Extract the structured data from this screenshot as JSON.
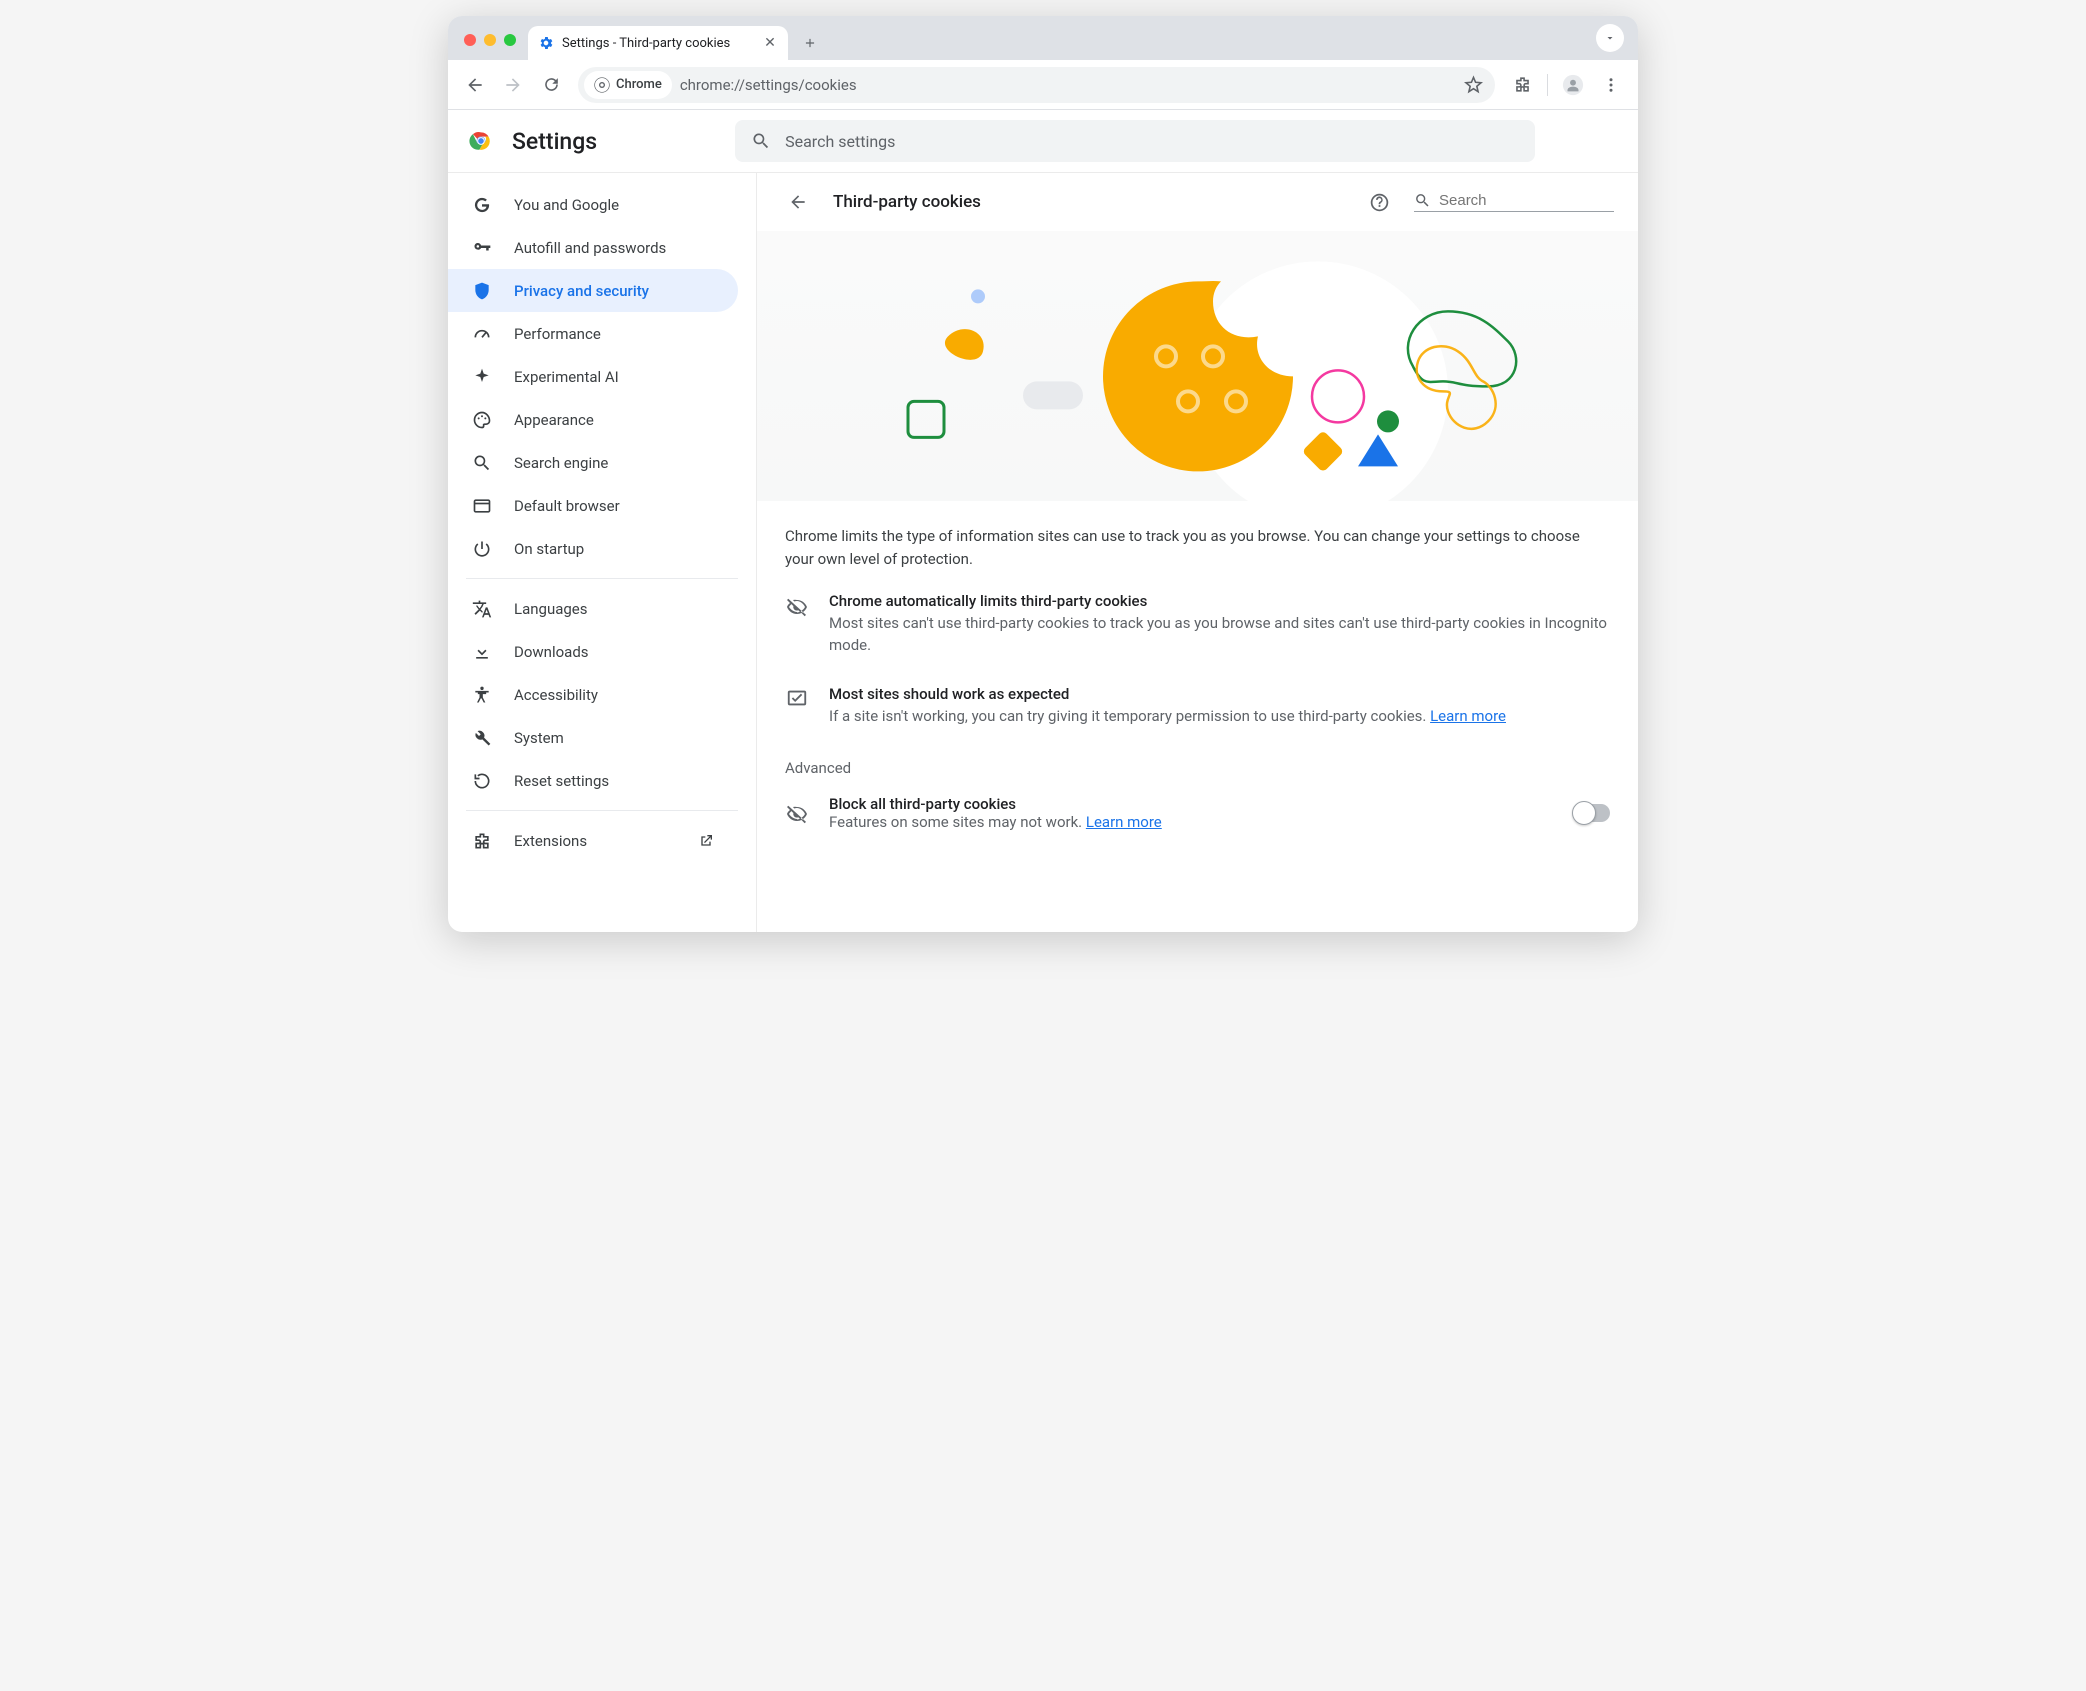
{
  "window": {
    "tab_title": "Settings - Third-party cookies",
    "url": "chrome://settings/cookies",
    "chip_label": "Chrome"
  },
  "header": {
    "title": "Settings",
    "search_placeholder": "Search settings"
  },
  "sidebar": {
    "items": [
      {
        "label": "You and Google"
      },
      {
        "label": "Autofill and passwords"
      },
      {
        "label": "Privacy and security"
      },
      {
        "label": "Performance"
      },
      {
        "label": "Experimental AI"
      },
      {
        "label": "Appearance"
      },
      {
        "label": "Search engine"
      },
      {
        "label": "Default browser"
      },
      {
        "label": "On startup"
      }
    ],
    "items2": [
      {
        "label": "Languages"
      },
      {
        "label": "Downloads"
      },
      {
        "label": "Accessibility"
      },
      {
        "label": "System"
      },
      {
        "label": "Reset settings"
      }
    ],
    "extensions": "Extensions"
  },
  "page": {
    "title": "Third-party cookies",
    "search_placeholder": "Search",
    "description": "Chrome limits the type of information sites can use to track you as you browse. You can change your settings to choose your own level of protection.",
    "info1_title": "Chrome automatically limits third-party cookies",
    "info1_body": "Most sites can't use third-party cookies to track you as you browse and sites can't use third-party cookies in Incognito mode.",
    "info2_title": "Most sites should work as expected",
    "info2_body": "If a site isn't working, you can try giving it temporary permission to use third-party cookies. ",
    "learn_more": "Learn more",
    "advanced_label": "Advanced",
    "block_title": "Block all third-party cookies",
    "block_body": "Features on some sites may not work. "
  }
}
